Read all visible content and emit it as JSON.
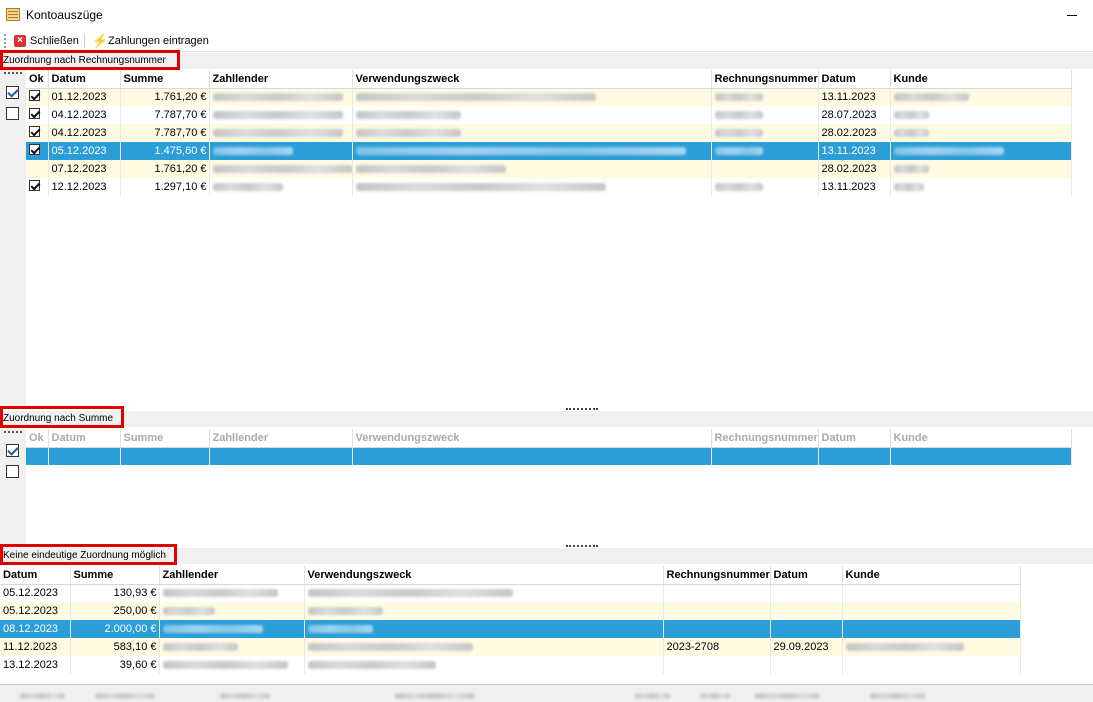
{
  "window": {
    "title": "Kontoauszüge"
  },
  "toolbar": {
    "close_label": "Schließen",
    "enter_payments_label": "Zahlungen eintragen"
  },
  "section1": {
    "label": "Zuordnung nach Rechnungsnummer",
    "columns": [
      "Ok",
      "Datum",
      "Summe",
      "Zahllender",
      "Verwendungszweck",
      "Rechnungsnummer",
      "Datum",
      "Kunde"
    ],
    "rows": [
      {
        "ok": true,
        "datum": "01.12.2023",
        "summe": "1.761,20 €",
        "rdatum": "13.11.2023"
      },
      {
        "ok": true,
        "datum": "04.12.2023",
        "summe": "7.787,70 €",
        "rdatum": "28.07.2023"
      },
      {
        "ok": true,
        "datum": "04.12.2023",
        "summe": "7.787,70 €",
        "rdatum": "28.02.2023"
      },
      {
        "ok": true,
        "datum": "05.12.2023",
        "summe": "1.475,60 €",
        "rdatum": "13.11.2023"
      },
      {
        "ok": false,
        "datum": "07.12.2023",
        "summe": "1.761,20 €",
        "rdatum": "28.02.2023"
      },
      {
        "ok": true,
        "datum": "12.12.2023",
        "summe": "1.297,10 €",
        "rdatum": "13.11.2023"
      }
    ]
  },
  "section2": {
    "label": "Zuordnung nach Summe",
    "columns": [
      "Ok",
      "Datum",
      "Summe",
      "Zahllender",
      "Verwendungszweck",
      "Rechnungsnummer",
      "Datum",
      "Kunde"
    ]
  },
  "section3": {
    "label": "Keine eindeutige Zuordnung möglich",
    "columns": [
      "Datum",
      "Summe",
      "Zahllender",
      "Verwendungszweck",
      "Rechnungsnummer",
      "Datum",
      "Kunde"
    ],
    "rows": [
      {
        "datum": "05.12.2023",
        "summe": "130,93 €",
        "rnr": "",
        "rdatum": ""
      },
      {
        "datum": "05.12.2023",
        "summe": "250,00 €",
        "rnr": "",
        "rdatum": ""
      },
      {
        "datum": "08.12.2023",
        "summe": "2.000,00 €",
        "rnr": "",
        "rdatum": ""
      },
      {
        "datum": "11.12.2023",
        "summe": "583,10 €",
        "rnr": "2023-2708",
        "rdatum": "29.09.2023"
      },
      {
        "datum": "13.12.2023",
        "summe": "39,60 €",
        "rnr": "",
        "rdatum": ""
      }
    ]
  },
  "colors": {
    "selection": "#2b9ed8",
    "alt_row": "#fffbe3",
    "highlight_box": "#e00000"
  },
  "icons": {
    "close": "close-x-icon",
    "enter": "lightning-icon",
    "app": "window-app-icon"
  }
}
